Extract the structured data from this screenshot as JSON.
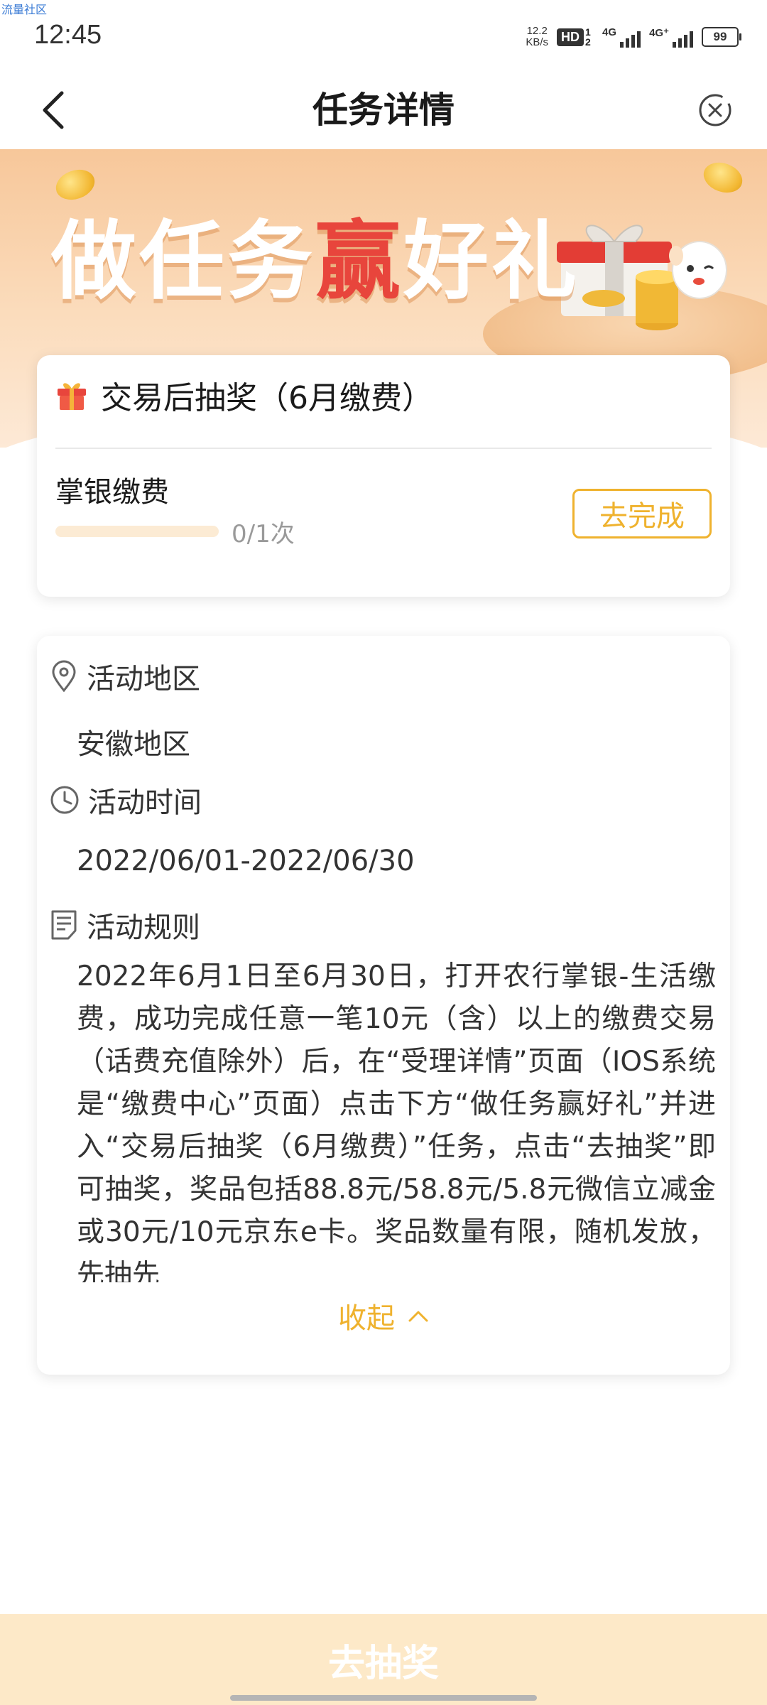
{
  "watermark": "流量社区",
  "status_bar": {
    "time": "12:45",
    "net_speed_value": "12.2",
    "net_speed_unit": "KB/s",
    "hd_badge": "HD",
    "hd_sims": "1 2",
    "signal1_label": "4G",
    "signal2_label": "4G⁺",
    "battery": "99"
  },
  "header": {
    "title": "任务详情"
  },
  "banner": {
    "title_part1": "做任务",
    "title_highlight": "赢",
    "title_part2": "好礼",
    "accent_color": "#e8453c"
  },
  "task_card": {
    "title": "交易后抽奖（6月缴费）",
    "item_name": "掌银缴费",
    "progress_fraction": 0,
    "progress_text": "0/1次",
    "complete_button": "去完成"
  },
  "info_card": {
    "region_label": "活动地区",
    "region_value": "安徽地区",
    "time_label": "活动时间",
    "time_value": "2022/06/01-2022/06/30",
    "rules_label": "活动规则",
    "rules_text": "2022年6月1日至6月30日，打开农行掌银-生活缴费，成功完成任意一笔10元（含）以上的缴费交易（话费充值除外）后，在“受理详情”页面（IOS系统是“缴费中心”页面）点击下方“做任务赢好礼”并进入“交易后抽奖（6月缴费）”任务，点击“去抽奖”即可抽奖，奖品包括88.8元/58.8元/5.8元微信立减金或30元/10元京东e卡。奖品数量有限，随机发放，先抽先",
    "collapse_label": "收起"
  },
  "bottom": {
    "draw_button": "去抽奖"
  },
  "colors": {
    "brand_orange": "#efb22e",
    "draw_button_bg": "#fde9c8"
  }
}
